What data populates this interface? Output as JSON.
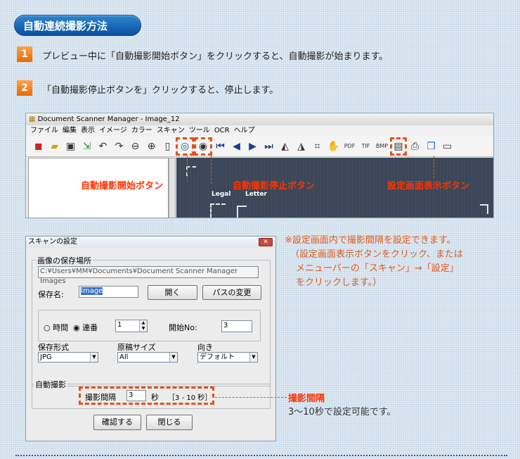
{
  "header": {
    "title": "自動連続撮影方法"
  },
  "steps": [
    {
      "num": "1",
      "text": "プレビュー中に「自動撮影開始ボタン」をクリックすると、自動撮影が始まります。"
    },
    {
      "num": "2",
      "text": "「自動撮影停止ボタンを」クリックすると、停止します。"
    }
  ],
  "app": {
    "title": "Document Scanner Manager - Image_12",
    "menu": [
      "ファイル",
      "編集",
      "表示",
      "イメージ",
      "カラー",
      "スキャン",
      "ツール",
      "OCR",
      "ヘルプ"
    ],
    "toolbar_icons": [
      "camera-icon",
      "folder-open-icon",
      "save-icon",
      "export-icon",
      "rotate-left-icon",
      "rotate-right-icon",
      "zoom-out-icon",
      "zoom-in-icon",
      "page-icon",
      "auto-capture-start-icon",
      "auto-capture-stop-icon",
      "first-page-icon",
      "previous-icon",
      "next-icon",
      "last-page-icon",
      "flip-horizontal-icon",
      "flip-vertical-icon",
      "crop-icon",
      "hand-icon",
      "pdf-icon",
      "tif-icon",
      "bmp-icon",
      "settings-screen-icon",
      "print-icon",
      "copy-icon",
      "window-icon"
    ],
    "annotations": {
      "start": "自動撮影開始ボタン",
      "stop": "自動撮影停止ボタン",
      "settings": "設定画面表示ボタン"
    },
    "preview_labels": {
      "legal": "Legal",
      "letter": "Letter"
    }
  },
  "dialog": {
    "title": "スキャンの設定",
    "close": "✕",
    "save_group": "画像の保存場所",
    "path": "C:¥Users¥MM¥Documents¥Document Scanner Manager Images",
    "save_name_label": "保存名:",
    "save_name_value": "Image",
    "open_button": "開く",
    "change_path_button": "パスの変更",
    "radio_time": "時間",
    "radio_serial": "連番",
    "serial_value": "1",
    "start_no_label": "開始No:",
    "start_no_value": "3",
    "format_label": "保存形式",
    "format_value": "JPG",
    "size_label": "原稿サイズ",
    "size_value": "All",
    "orientation_label": "向き",
    "orientation_value": "デフォルト",
    "auto_group": "自動撮影",
    "interval_label": "撮影間隔",
    "interval_value": "3",
    "interval_unit": "秒",
    "interval_range": "［3 - 10 秒］",
    "confirm_button": "確認する",
    "close_button": "閉じる"
  },
  "notes": {
    "lines": [
      "※設定画面内で撮影間隔を設定できます。",
      "（設定画面表示ボタンをクリック、または",
      "メニューバーの「スキャン」→「設定」",
      "をクリックします。）"
    ],
    "interval_title": "撮影間隔",
    "interval_desc": "3〜10秒で設定可能です。"
  },
  "colors": {
    "accent": "#e8511a",
    "title_bg": "#1a63b8",
    "step_bg": "#f08a1e"
  }
}
